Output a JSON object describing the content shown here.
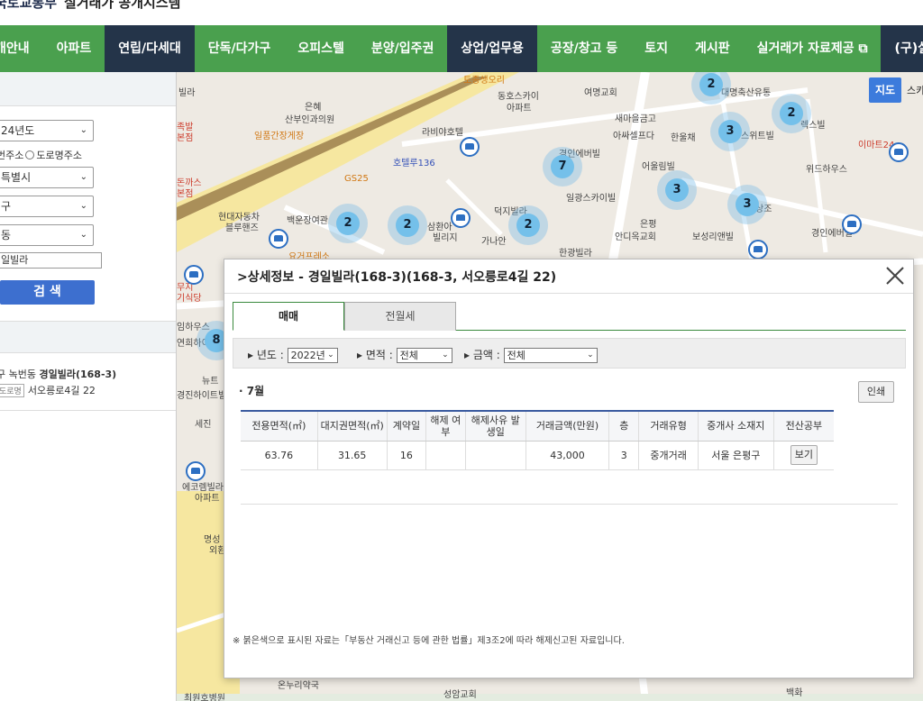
{
  "header": {
    "logo_text": "국토교통부",
    "site_name": "실거래가 공개시스템"
  },
  "nav": {
    "items": [
      "개안내",
      "아파트",
      "연립/다세대",
      "단독/다가구",
      "오피스텔",
      "분양/입주권",
      "상업/업무용",
      "공장/창고 등",
      "토지",
      "게시판",
      "실거래가 자료제공",
      "(구)실"
    ],
    "dark_items": [
      2,
      6,
      11
    ]
  },
  "sidebar": {
    "year": "24년도",
    "radio_jibun": "번주소",
    "radio_road": "도로명주소",
    "city": "특별시",
    "district": "구",
    "dong": "동",
    "complex_input": "일빌라",
    "search_label": "검 색",
    "result_prefix": "구 녹번동",
    "result_name": "경일빌라(168-3)",
    "result_road_tag": "도로명",
    "result_road_addr": "서오릉로4길 22"
  },
  "map": {
    "toggle_map": "지도",
    "toggle_sky": "스카",
    "labels": [
      "빌라",
      "은혜",
      "산부인과의원",
      "일품간장게장",
      "라비야호텔",
      "호텔루136",
      "GS25",
      "현대자동차",
      "블루핸즈",
      "백운장여관",
      "삼환아",
      "빌리지",
      "가나안",
      "한광빌라",
      "덕지빌라",
      "은평",
      "안디옥교회",
      "보성리앤빌",
      "경인에버빌",
      "경인에버빌",
      "어울림빌",
      "일광스카이빌",
      "위드하우스",
      "이마트24",
      "새마을금고",
      "아싸셀프다",
      "한울채",
      "여명교회",
      "대명축산유통",
      "동호스카이",
      "아파트",
      "토종생오리",
      "요거프레소",
      "돈까스",
      "본점",
      "족발",
      "본점",
      "무지",
      "기식당",
      "임하우스",
      "연희하이",
      "뉴트",
      "경진하이트빌",
      "세진",
      "에코렘빌라",
      "아파트",
      "명성",
      "외환",
      "온누리약국",
      "최원호병원",
      "성암교회",
      "백화",
      "스위트빌",
      "렉스빌",
      "상조"
    ],
    "cluster_counts": [
      "2",
      "2",
      "2",
      "7",
      "3",
      "3",
      "2",
      "3",
      "2",
      "8"
    ]
  },
  "modal": {
    "title": "상세정보 - 경일빌라(168-3)(168-3, 서오릉로4길 22)",
    "tabs": [
      "매매",
      "전월세"
    ],
    "filter_year_label": "년도 :",
    "filter_year_value": "2022년",
    "filter_area_label": "면적 :",
    "filter_area_value": "전체",
    "filter_price_label": "금액 :",
    "filter_price_value": "전체",
    "month": "7월",
    "print_label": "인쇄",
    "columns": [
      "전용면적(㎡)",
      "대지권면적(㎡)",
      "계약일",
      "해제 여부",
      "해제사유 발생일",
      "거래금액(만원)",
      "층",
      "거래유형",
      "중개사 소재지",
      "전산공부"
    ],
    "rows": [
      [
        "63.76",
        "31.65",
        "16",
        "",
        "",
        "43,000",
        "3",
        "중개거래",
        "서울 은평구",
        "보기"
      ]
    ],
    "note": "※ 붉은색으로 표시된 자료는「부동산 거래신고 등에 관한 법률」제3조2에 따라 해제신고된 자료입니다."
  }
}
